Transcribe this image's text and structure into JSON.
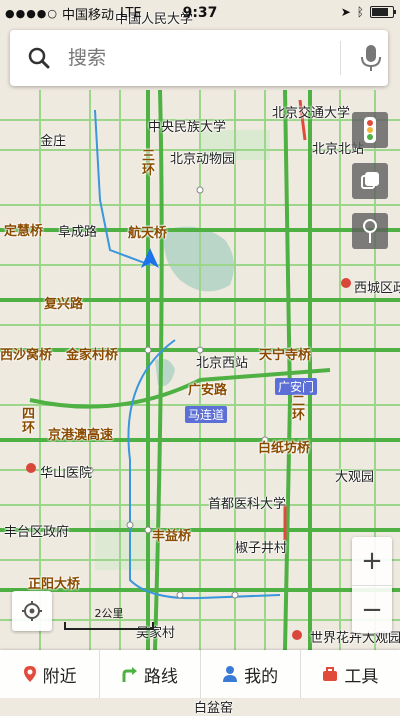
{
  "status_bar": {
    "signal": "●●●●○",
    "carrier": "中国移动",
    "network": "LTE",
    "time": "9:37"
  },
  "search": {
    "placeholder": "搜索"
  },
  "map_labels": {
    "renmin_univ": "中国人民大学",
    "minzu_univ": "中央民族大学",
    "jiaotong_univ": "北京交通大学",
    "jinsong": "金庄",
    "zoo": "北京动物园",
    "beijing_north": "北京北站",
    "sanhuan_top": "三环",
    "dinghui": "定慧桥",
    "fucheng": "阜成路",
    "hangtian": "航天桥",
    "xicheng": "西城区政府",
    "fuxing": "复兴路",
    "shawo": "西沙窝桥",
    "jinjia": "金家村桥",
    "beijing_west": "北京西站",
    "tianning": "天宁寺桥",
    "guanganmen_street": "广安路",
    "guanganmen": "广安门",
    "erhuan": "二环",
    "maliandao": "马连道",
    "sihuan": "四环",
    "jinggangao": "京港澳高速",
    "huashan": "华山医院",
    "baizhifang": "白纸坊桥",
    "daguanyuan": "大观园",
    "capital_med": "首都医科大学",
    "fengtai_gov": "丰台区政府",
    "fengyi": "丰益桥",
    "jiaoziyin": "椒子井村",
    "zhengyang": "正阳大桥",
    "jiaojia": "吴家村",
    "flower_market": "世界花卉大观园",
    "baipen": "白盆窑"
  },
  "scale": {
    "label": "2公里"
  },
  "bottom_nav": {
    "nearby": "附近",
    "route": "路线",
    "mine": "我的",
    "tools": "工具"
  },
  "colors": {
    "road_green": "#6ec85a",
    "major_road": "#4fb043",
    "river": "#5aa7e0",
    "route_line": "#3a96dd"
  }
}
